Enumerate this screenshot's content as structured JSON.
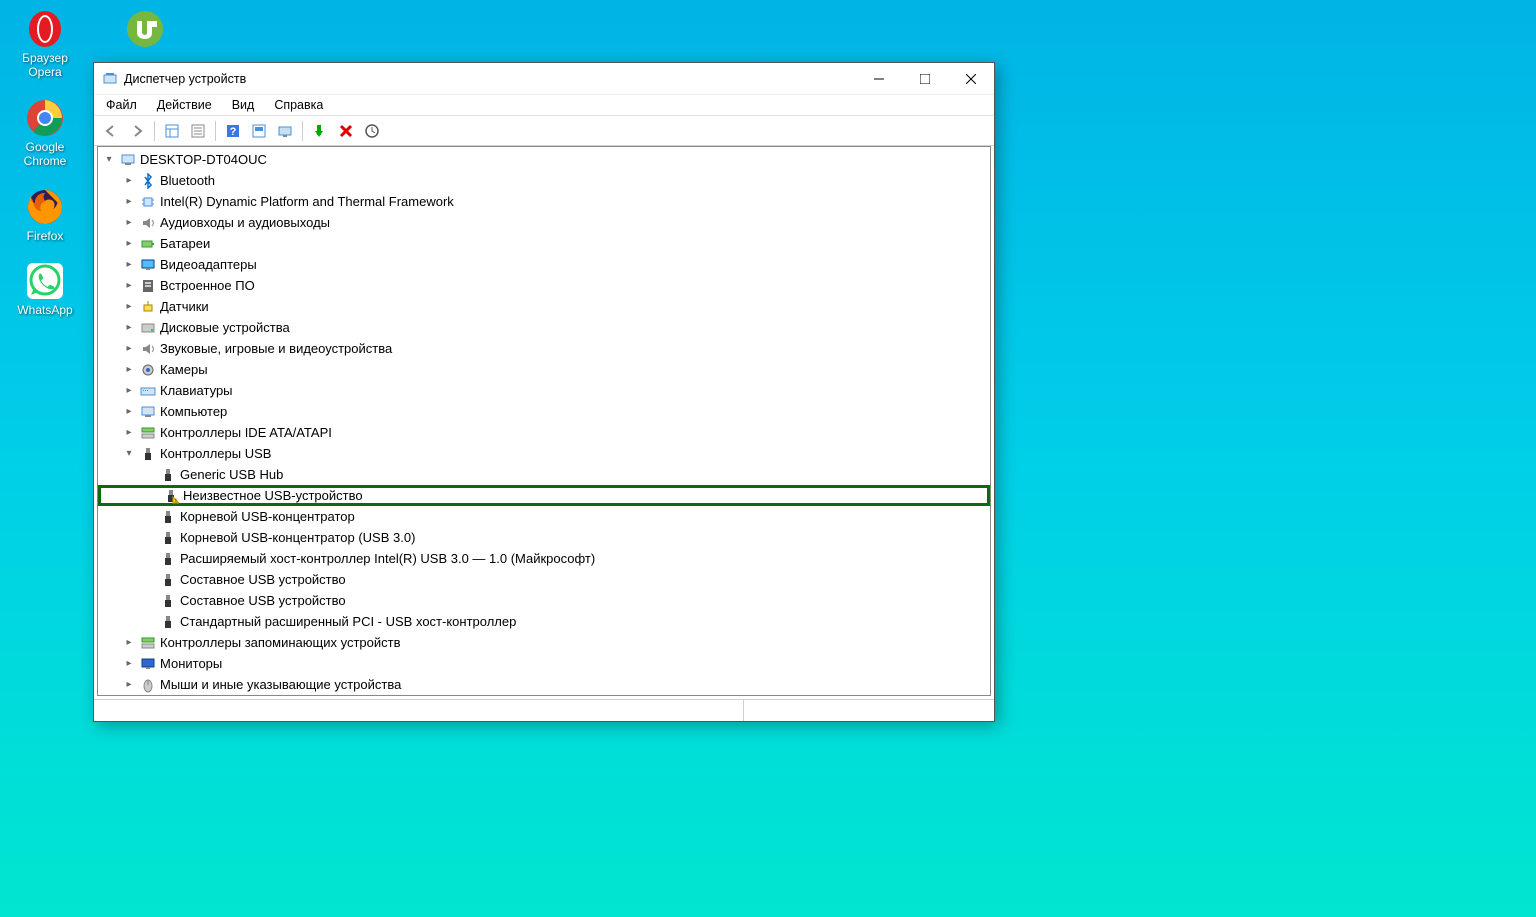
{
  "desktop": [
    {
      "label": "Браузер\nOpera",
      "icon": "opera"
    },
    {
      "label": "Google\nChrome",
      "icon": "chrome"
    },
    {
      "label": "Firefox",
      "icon": "firefox"
    },
    {
      "label": "WhatsApp",
      "icon": "whatsapp"
    }
  ],
  "utorrent_label": "",
  "window": {
    "title": "Диспетчер устройств",
    "menu": [
      "Файл",
      "Действие",
      "Вид",
      "Справка"
    ]
  },
  "tree": {
    "root": "DESKTOP-DT04OUC",
    "cats": [
      {
        "label": "Bluetooth",
        "icon": "bt"
      },
      {
        "label": "Intel(R) Dynamic Platform and Thermal Framework",
        "icon": "chip"
      },
      {
        "label": "Аудиовходы и аудиовыходы",
        "icon": "audio"
      },
      {
        "label": "Батареи",
        "icon": "battery"
      },
      {
        "label": "Видеоадаптеры",
        "icon": "display"
      },
      {
        "label": "Встроенное ПО",
        "icon": "firmware"
      },
      {
        "label": "Датчики",
        "icon": "sensor"
      },
      {
        "label": "Дисковые устройства",
        "icon": "disk"
      },
      {
        "label": "Звуковые, игровые и видеоустройства",
        "icon": "audio"
      },
      {
        "label": "Камеры",
        "icon": "camera"
      },
      {
        "label": "Клавиатуры",
        "icon": "keyboard"
      },
      {
        "label": "Компьютер",
        "icon": "pc"
      },
      {
        "label": "Контроллеры IDE ATA/ATAPI",
        "icon": "storage"
      }
    ],
    "usb_label": "Контроллеры USB",
    "usb": [
      {
        "label": "Generic USB Hub",
        "warn": false
      },
      {
        "label": "Неизвестное USB-устройство",
        "warn": true,
        "highlight": true
      },
      {
        "label": "Корневой USB-концентратор",
        "warn": false
      },
      {
        "label": "Корневой USB-концентратор (USB 3.0)",
        "warn": false
      },
      {
        "label": "Расширяемый хост-контроллер Intel(R) USB 3.0 — 1.0 (Майкрософт)",
        "warn": false
      },
      {
        "label": "Составное USB устройство",
        "warn": false
      },
      {
        "label": "Составное USB устройство",
        "warn": false
      },
      {
        "label": "Стандартный расширенный PCI - USB хост-контроллер",
        "warn": false
      }
    ],
    "tail": [
      {
        "label": "Контроллеры запоминающих устройств",
        "icon": "storage"
      },
      {
        "label": "Мониторы",
        "icon": "monitor"
      },
      {
        "label": "Мыши и иные указывающие устройства",
        "icon": "mouse"
      }
    ]
  }
}
